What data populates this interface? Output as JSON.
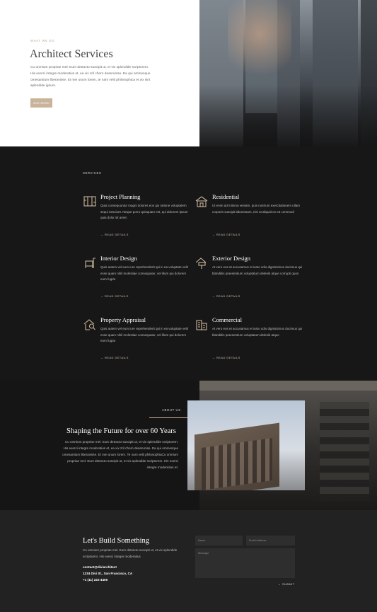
{
  "hero": {
    "eyebrow": "WHAT WE DO",
    "title": "Architect Services",
    "body": "Cu omnium propriae mel. Eum detracto suscipit ut, et vix splendide scriptorem. His exerci integre moderatius et, ea vix zril choro deserunise. Ea qui ommesque omesantium liberavisse. Ei mei unum lorem, te nam velit philosophica et vix sint splendide ignum.",
    "button_label": "OUR WORK"
  },
  "services": {
    "section_label": "SERVICES",
    "items": [
      {
        "icon": "floorplan-icon",
        "title": "Project Planning",
        "body": "Quia consequuntur magni dolores eos qui ratione voluptatem sequi nesciunt. Neque porro quisquam est, qui dolorem ipsum quia dolor sit amet.",
        "link": "→ READ DETAILS"
      },
      {
        "icon": "house-icon",
        "title": "Residential",
        "body": "Ut enim ad minima veniam, quis nostrum exercitationem ullam corporis suscipit laboriosam, nisi ut aliquid ex ea commodi",
        "link": "→ READ DETAILS"
      },
      {
        "icon": "chair-icon",
        "title": "Interior Design",
        "body": "Quis autem vel eum iure reprehenderit qui in ea voluptate velit esse quam nihil molestiae consequatur, vel illum qui dolorem eum fugiat",
        "link": "→ READ DETAILS"
      },
      {
        "icon": "paint-roller-icon",
        "title": "Exterior Design",
        "body": "At vero eos et accusamus et iusto odio dignissimos ducimus qui blanditiis praesentium voluptatum deleniti atque corrupti quos",
        "link": "→ READ DETAILS"
      },
      {
        "icon": "house-search-icon",
        "title": "Property Appraisal",
        "body": "Quis autem vel eum iure reprehenderit qui in ea voluptate velit esse quam nihil molestiae consequatur, vel illum qui dolorem eum fugiat",
        "link": "→ READ DETAILS"
      },
      {
        "icon": "commercial-building-icon",
        "title": "Commercial",
        "body": "At vero eos et accusamus et iusto odio dignissimos ducimus qui blanditiis praesentium voluptatum deleniti atque",
        "link": "→ READ DETAILS"
      }
    ]
  },
  "about": {
    "label": "ABOUT US",
    "title": "Shaping the Future for over 60 Years",
    "body": "Cu omnium propriae mel. Eum detracto suscipit ut, et vix splendide scriptorem. His exerci integre moderatius et, ea vix zril choro deserunise. Ea qui ommesque omesantium liberavisse. Ei mei unum lorem. Te nam velit philosophiaCu omnium propriae mel. Eum detracto suscipit ut, et vix splendide scriptorem. His exerci integre moderatius et."
  },
  "contact": {
    "title": "Let's Build Something",
    "body": "Cu omnium propriae mel. Eum detracto suscipit ut, et vix splendide scriptorem. His exerci integre moderatius",
    "email": "contact@diviarchitect",
    "address": "1234 Divi St., San Francisco, CA",
    "phone": "+1 (11) 222-4405",
    "name_placeholder": "Name",
    "email_placeholder": "Email Address",
    "message_placeholder": "Message",
    "submit_label": "→ SUBMIT"
  },
  "colors": {
    "accent": "#c9b49b",
    "dark_bg": "#171717",
    "contact_bg": "#222222"
  }
}
